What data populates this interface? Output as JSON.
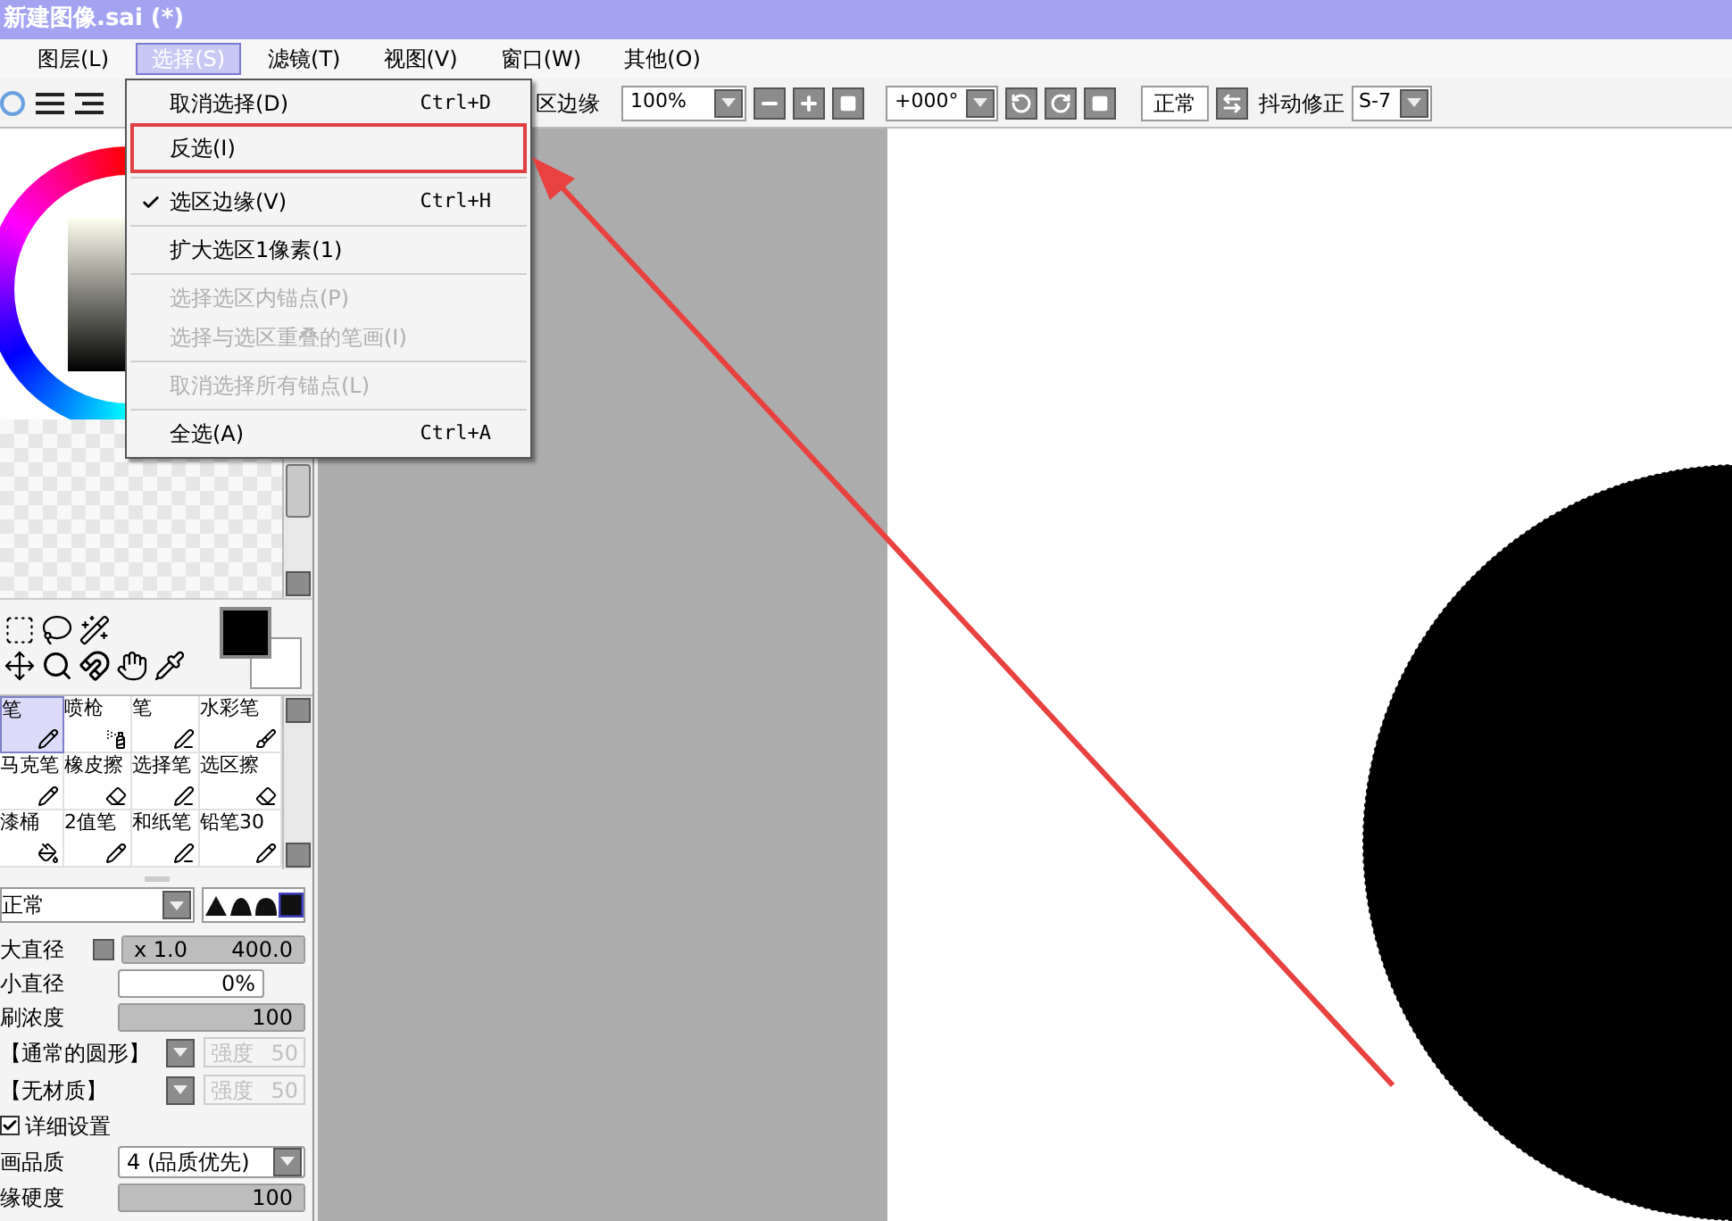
{
  "window": {
    "title": "新建图像.sai (*)"
  },
  "menu_bar": [
    {
      "label": "图层(L)",
      "selected": false
    },
    {
      "label": "选择(S)",
      "selected": true
    },
    {
      "label": "滤镜(T)",
      "selected": false
    },
    {
      "label": "视图(V)",
      "selected": false
    },
    {
      "label": "窗口(W)",
      "selected": false
    },
    {
      "label": "其他(O)",
      "selected": false
    }
  ],
  "dropdown_menu": {
    "groups": [
      [
        {
          "label": "取消选择(D)",
          "shortcut": "Ctrl+D",
          "checked": false,
          "disabled": false,
          "annotated": false
        },
        {
          "label": "反选(I)",
          "checked": false,
          "disabled": false,
          "annotated": true
        }
      ],
      [
        {
          "label": "选区边缘(V)",
          "shortcut": "Ctrl+H",
          "checked": true,
          "disabled": false,
          "annotated": false
        }
      ],
      [
        {
          "label": "扩大选区1像素(1)",
          "checked": false,
          "disabled": false,
          "annotated": false
        }
      ],
      [
        {
          "label": "选择选区内锚点(P)",
          "checked": false,
          "disabled": true,
          "annotated": false
        },
        {
          "label": "选择与选区重叠的笔画(I)",
          "checked": false,
          "disabled": true,
          "annotated": false
        }
      ],
      [
        {
          "label": "取消选择所有锚点(L)",
          "checked": false,
          "disabled": true,
          "annotated": false
        }
      ],
      [
        {
          "label": "全选(A)",
          "shortcut": "Ctrl+A",
          "checked": false,
          "disabled": false,
          "annotated": false
        }
      ]
    ]
  },
  "toolbar": {
    "selection_edge_label": "区边缘",
    "zoom": "100%",
    "rotation": "+000°",
    "blend_mode": "正常",
    "stabilizer_label": "抖动修正",
    "stabilizer": "S-7"
  },
  "brushes": [
    {
      "label": "笔",
      "selected": true
    },
    {
      "label": "喷枪",
      "selected": false
    },
    {
      "label": "笔",
      "selected": false
    },
    {
      "label": "水彩笔",
      "selected": false
    },
    {
      "label": "马克笔",
      "selected": false
    },
    {
      "label": "橡皮擦",
      "selected": false
    },
    {
      "label": "选择笔",
      "selected": false
    },
    {
      "label": "选区擦",
      "selected": false
    },
    {
      "label": "漆桶",
      "selected": false
    },
    {
      "label": "2值笔",
      "selected": false
    },
    {
      "label": "和纸笔",
      "selected": false
    },
    {
      "label": "铅笔30",
      "selected": false
    }
  ],
  "brush_settings": {
    "mode": "正常",
    "tip_shapes": [
      {
        "selected": false
      },
      {
        "selected": false
      },
      {
        "selected": false
      },
      {
        "selected": true
      }
    ],
    "max_size": {
      "label": "大直径",
      "multiplier": "x 1.0",
      "value": "400.0",
      "level": 1
    },
    "min_size": {
      "label": "小直径",
      "value": "0%"
    },
    "density": {
      "label": "刷浓度",
      "value": "100",
      "level": 1
    },
    "textures": [
      {
        "name": "【通常的圆形】",
        "strength_label": "强度",
        "strength": "50",
        "disabled": true
      },
      {
        "name": "【无材质】",
        "strength_label": "强度",
        "strength": "50",
        "disabled": true
      }
    ],
    "details": {
      "label": "详细设置",
      "checked": true
    },
    "quality": {
      "label": "画品质",
      "value": "4 (品质优先)"
    },
    "edge_hardness": {
      "label": "缘硬度",
      "value": "100",
      "level": 1
    }
  }
}
